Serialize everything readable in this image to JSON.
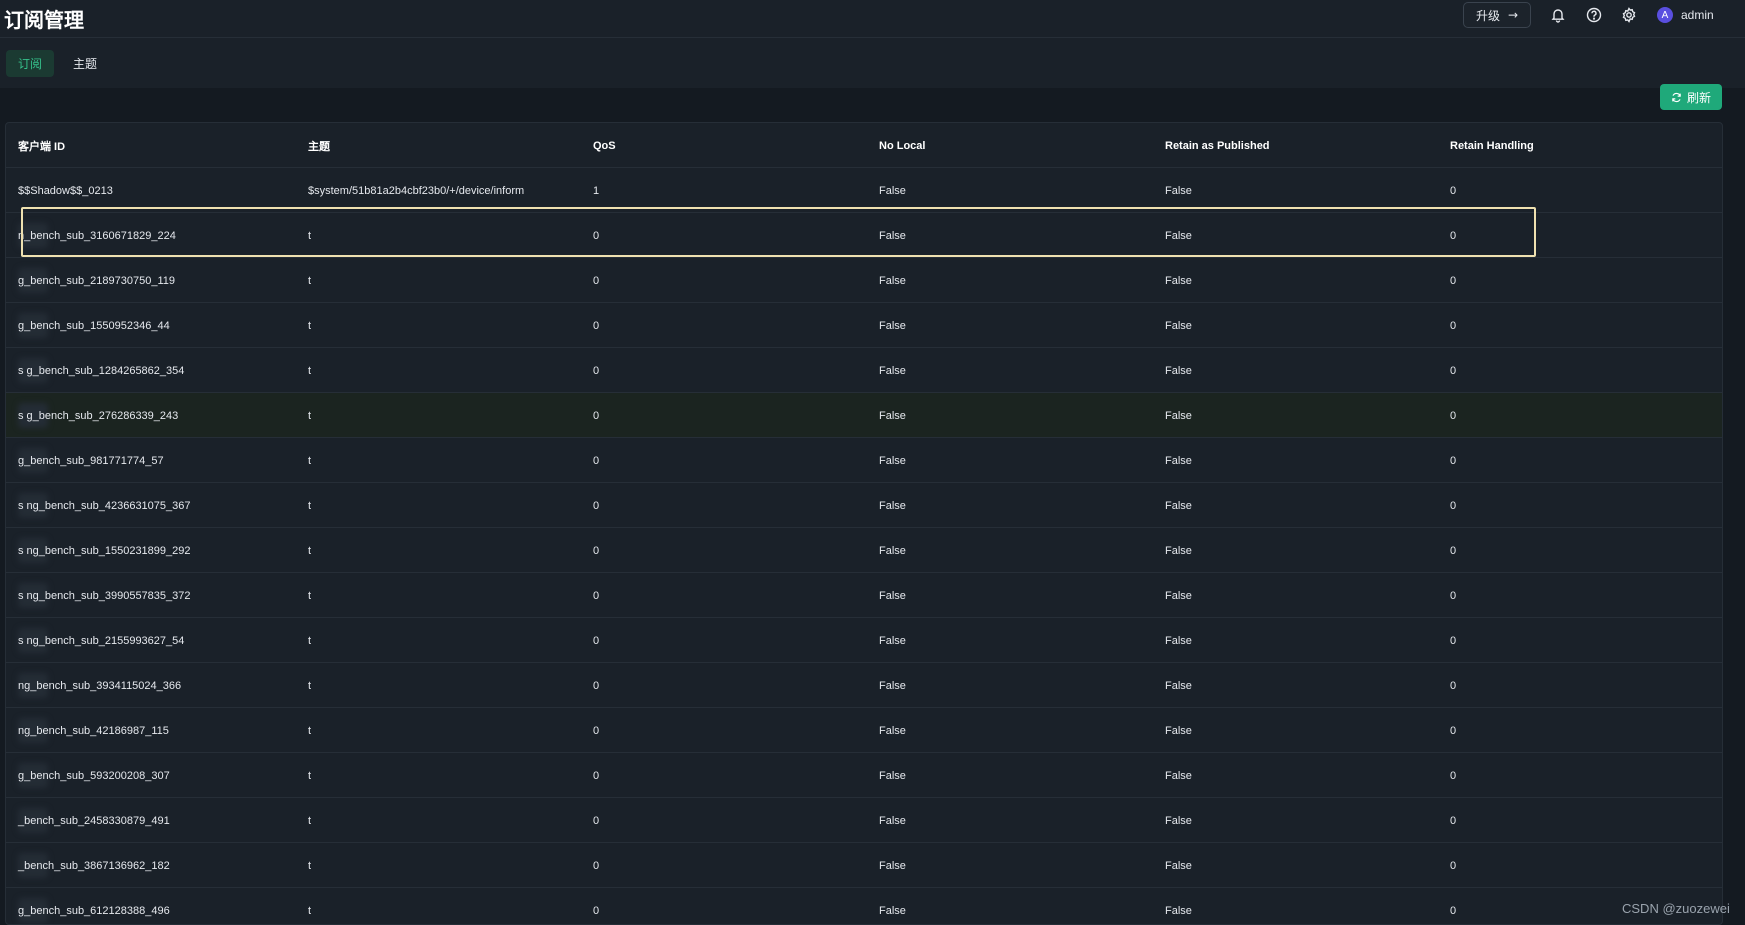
{
  "header": {
    "title": "订阅管理",
    "upgrade_label": "升级",
    "upgrade_arrow": "→",
    "icons": [
      "bell-icon",
      "help-icon",
      "gear-icon"
    ],
    "user": {
      "avatar_letter": "A",
      "name": "admin"
    }
  },
  "tabs": [
    {
      "label": "订阅",
      "active": true
    },
    {
      "label": "主题",
      "active": false
    }
  ],
  "toolbar": {
    "refresh_label": "刷新"
  },
  "colors": {
    "accent": "#1fa97a",
    "active_tab_text": "#35c08b",
    "highlight_border": "#efe1b0",
    "avatar": "#5a4fe0"
  },
  "table": {
    "columns": [
      "客户端 ID",
      "主题",
      "QoS",
      "No Local",
      "Retain as Published",
      "Retain Handling"
    ],
    "rows": [
      {
        "client_id": "$$Shadow$$_0213",
        "topic": "$system/51b81a2b4cbf23b0/+/device/inform",
        "qos": "1",
        "no_local": "False",
        "retain_as_published": "False",
        "retain_handling": "0"
      },
      {
        "client_id": "n_bench_sub_3160671829_224",
        "topic": "t",
        "qos": "0",
        "no_local": "False",
        "retain_as_published": "False",
        "retain_handling": "0"
      },
      {
        "client_id": "g_bench_sub_2189730750_119",
        "topic": "t",
        "qos": "0",
        "no_local": "False",
        "retain_as_published": "False",
        "retain_handling": "0"
      },
      {
        "client_id": "g_bench_sub_1550952346_44",
        "topic": "t",
        "qos": "0",
        "no_local": "False",
        "retain_as_published": "False",
        "retain_handling": "0"
      },
      {
        "client_id": "s    g_bench_sub_1284265862_354",
        "topic": "t",
        "qos": "0",
        "no_local": "False",
        "retain_as_published": "False",
        "retain_handling": "0"
      },
      {
        "client_id": "s    g_bench_sub_276286339_243",
        "topic": "t",
        "qos": "0",
        "no_local": "False",
        "retain_as_published": "False",
        "retain_handling": "0"
      },
      {
        "client_id": "g_bench_sub_981771774_57",
        "topic": "t",
        "qos": "0",
        "no_local": "False",
        "retain_as_published": "False",
        "retain_handling": "0"
      },
      {
        "client_id": "s    ng_bench_sub_4236631075_367",
        "topic": "t",
        "qos": "0",
        "no_local": "False",
        "retain_as_published": "False",
        "retain_handling": "0"
      },
      {
        "client_id": "s    ng_bench_sub_1550231899_292",
        "topic": "t",
        "qos": "0",
        "no_local": "False",
        "retain_as_published": "False",
        "retain_handling": "0"
      },
      {
        "client_id": "s    ng_bench_sub_3990557835_372",
        "topic": "t",
        "qos": "0",
        "no_local": "False",
        "retain_as_published": "False",
        "retain_handling": "0"
      },
      {
        "client_id": "s    ng_bench_sub_2155993627_54",
        "topic": "t",
        "qos": "0",
        "no_local": "False",
        "retain_as_published": "False",
        "retain_handling": "0"
      },
      {
        "client_id": "ng_bench_sub_3934115024_366",
        "topic": "t",
        "qos": "0",
        "no_local": "False",
        "retain_as_published": "False",
        "retain_handling": "0"
      },
      {
        "client_id": "ng_bench_sub_42186987_115",
        "topic": "t",
        "qos": "0",
        "no_local": "False",
        "retain_as_published": "False",
        "retain_handling": "0"
      },
      {
        "client_id": "g_bench_sub_593200208_307",
        "topic": "t",
        "qos": "0",
        "no_local": "False",
        "retain_as_published": "False",
        "retain_handling": "0"
      },
      {
        "client_id": "_bench_sub_2458330879_491",
        "topic": "t",
        "qos": "0",
        "no_local": "False",
        "retain_as_published": "False",
        "retain_handling": "0"
      },
      {
        "client_id": "_bench_sub_3867136962_182",
        "topic": "t",
        "qos": "0",
        "no_local": "False",
        "retain_as_published": "False",
        "retain_handling": "0"
      },
      {
        "client_id": "g_bench_sub_612128388_496",
        "topic": "t",
        "qos": "0",
        "no_local": "False",
        "retain_as_published": "False",
        "retain_handling": "0"
      }
    ]
  },
  "watermark": "CSDN @zuozewei"
}
